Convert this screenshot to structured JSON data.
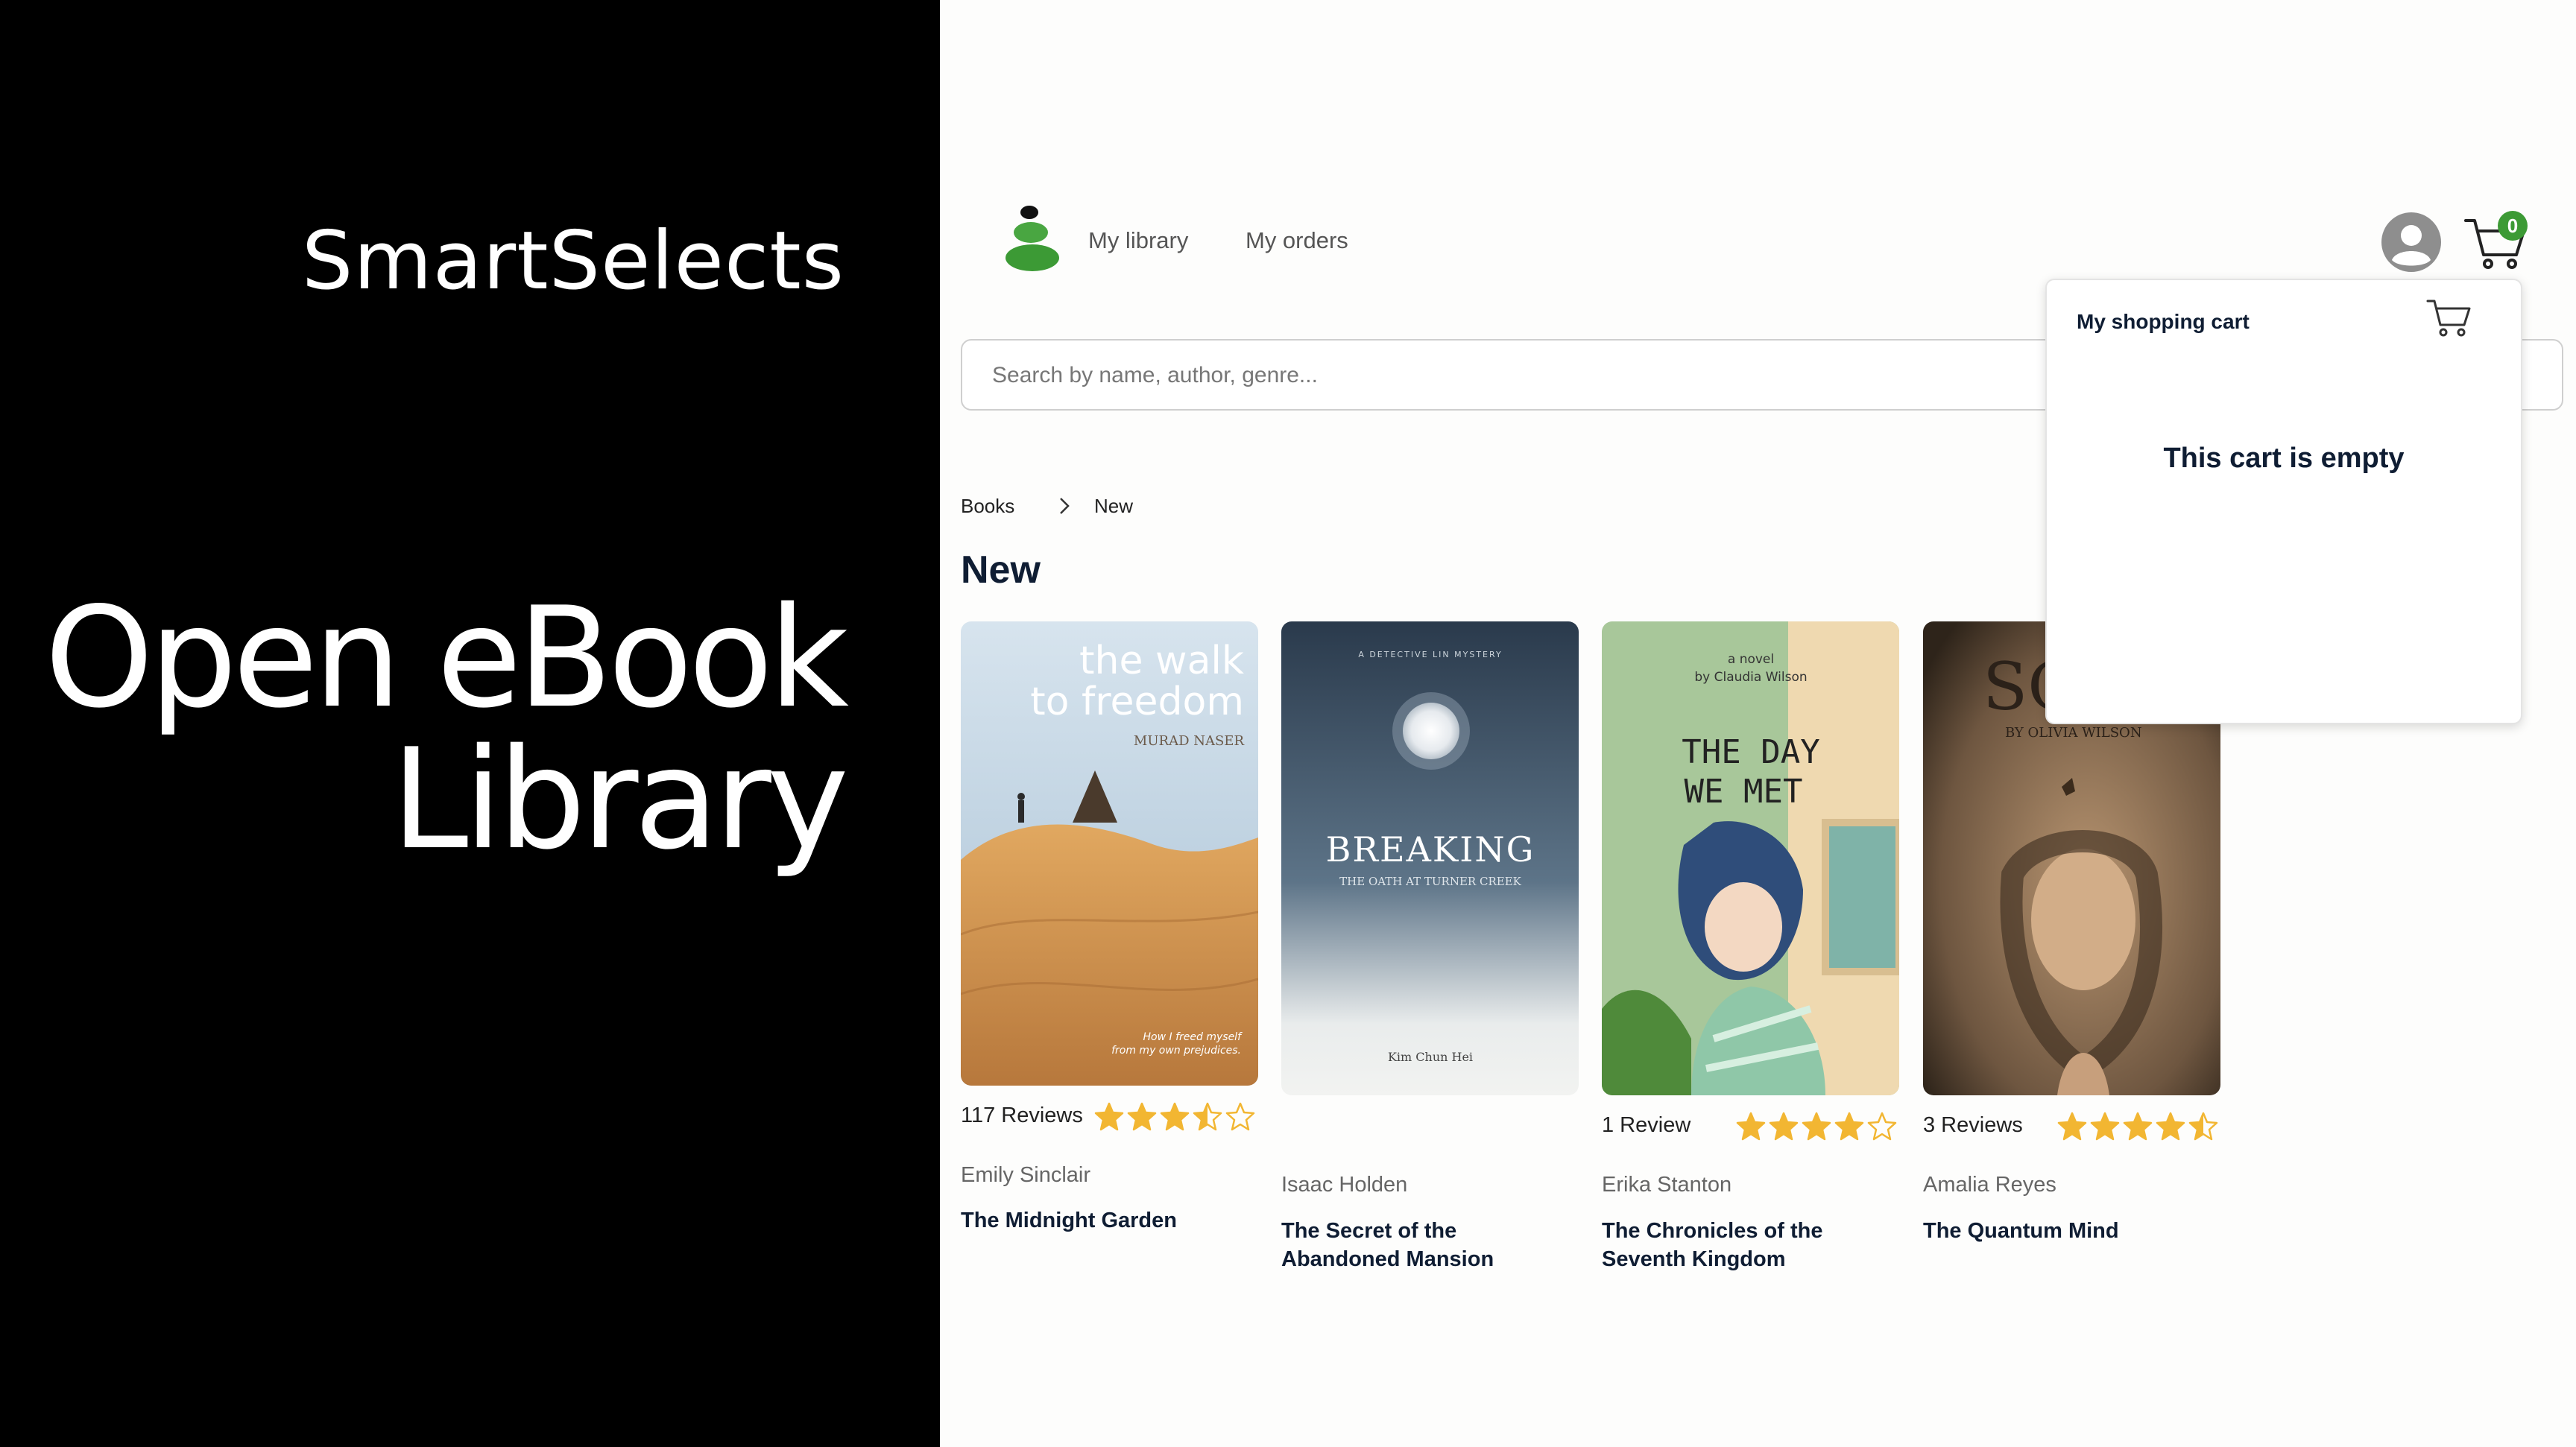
{
  "brand": {
    "name": "SmartSelects",
    "headline_line1": "Open eBook",
    "headline_line2": "Library"
  },
  "header": {
    "nav": [
      {
        "label": "My library"
      },
      {
        "label": "My orders"
      }
    ],
    "cart_count": "0"
  },
  "search": {
    "placeholder": "Search by name, author, genre..."
  },
  "breadcrumb": {
    "items": [
      "Books",
      "New"
    ]
  },
  "section": {
    "title": "New"
  },
  "books": [
    {
      "reviews_text": "117 Reviews",
      "rating": 3.5,
      "author": "Emily Sinclair",
      "title": "The Midnight Garden",
      "cover": {
        "title_line1": "the walk",
        "title_line2": "to freedom",
        "author": "MURAD NASER",
        "tagline1": "How I freed myself",
        "tagline2": "from my own prejudices."
      }
    },
    {
      "reviews_text": "",
      "rating": null,
      "author": "Isaac Holden",
      "title": "The Secret of the Abandoned Mansion",
      "cover": {
        "series": "A DETECTIVE LIN MYSTERY",
        "title": "BREAKING",
        "subtitle": "THE OATH AT TURNER CREEK",
        "author": "Kim Chun Hei"
      }
    },
    {
      "reviews_text": "1 Review",
      "rating": 4,
      "author": "Erika Stanton",
      "title": "The Chronicles of the Seventh Kingdom",
      "cover": {
        "tagline1": "a novel",
        "tagline2": "by Claudia Wilson",
        "title_line1": "THE DAY",
        "title_line2": "WE MET"
      }
    },
    {
      "reviews_text": "3 Reviews",
      "rating": 4.5,
      "author": "Amalia Reyes",
      "title": "The Quantum Mind",
      "cover": {
        "title": "SO",
        "author": "BY OLIVIA WILSON"
      }
    }
  ],
  "cart_panel": {
    "title": "My shopping cart",
    "empty_message": "This cart is empty"
  },
  "colors": {
    "accent_green": "#3c9a35",
    "star": "#f2b632",
    "heading_navy": "#0f1d33",
    "left_panel": "#000000"
  },
  "icons": {
    "logo": "stacked-stones-logo",
    "avatar": "user-avatar-icon",
    "cart": "shopping-cart-icon",
    "breadcrumb_sep": "chevron-right-icon",
    "star": "star-icon"
  }
}
